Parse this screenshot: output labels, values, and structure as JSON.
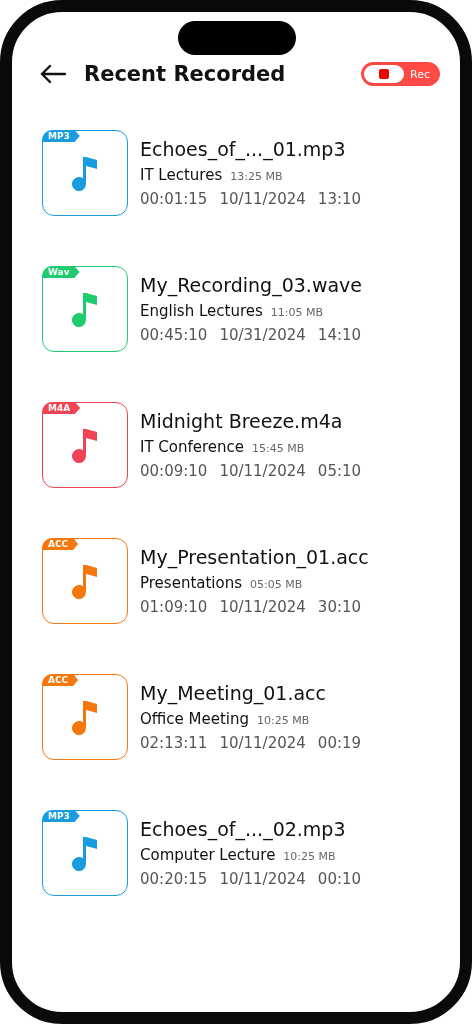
{
  "header": {
    "title": "Recent Recorded",
    "rec_toggle": {
      "label": "Rec",
      "on": true
    }
  },
  "recordings": [
    {
      "format": "MP3",
      "color": "#1a9de0",
      "name": "Echoes_of_..._01.mp3",
      "category": "IT Lectures",
      "size": "13:25 MB",
      "duration": "00:01:15",
      "date": "10/11/2024",
      "time": "13:10"
    },
    {
      "format": "Wav",
      "color": "#1fcb70",
      "name": "My_Recording_03.wave",
      "category": "English Lectures",
      "size": "11:05 MB",
      "duration": "00:45:10",
      "date": "10/31/2024",
      "time": "14:10"
    },
    {
      "format": "M4A",
      "color": "#f04455",
      "name": "Midnight Breeze.m4a",
      "category": "IT Conference",
      "size": "15:45 MB",
      "duration": "00:09:10",
      "date": "10/11/2024",
      "time": "05:10"
    },
    {
      "format": "ACC",
      "color": "#f5780f",
      "name": "My_Presentation_01.acc",
      "category": "Presentations",
      "size": "05:05 MB",
      "duration": "01:09:10",
      "date": "10/11/2024",
      "time": "30:10"
    },
    {
      "format": "ACC",
      "color": "#f5780f",
      "name": "My_Meeting_01.acc",
      "category": "Office Meeting",
      "size": "10:25 MB",
      "duration": "02:13:11",
      "date": "10/11/2024",
      "time": "00:19"
    },
    {
      "format": "MP3",
      "color": "#1a9de0",
      "name": "Echoes_of_..._02.mp3",
      "category": "Computer Lecture",
      "size": "10:25 MB",
      "duration": "00:20:15",
      "date": "10/11/2024",
      "time": "00:10"
    }
  ]
}
